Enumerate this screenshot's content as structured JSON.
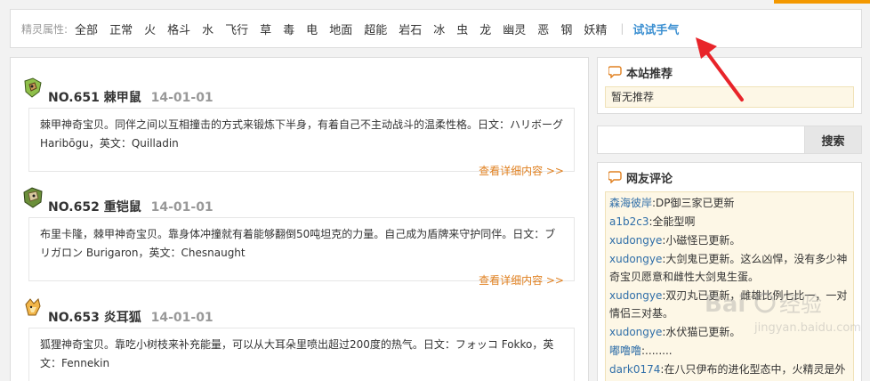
{
  "filter": {
    "label": "精灵属性:",
    "items": [
      "全部",
      "正常",
      "火",
      "格斗",
      "水",
      "飞行",
      "草",
      "毒",
      "电",
      "地面",
      "超能",
      "岩石",
      "冰",
      "虫",
      "龙",
      "幽灵",
      "恶",
      "钢",
      "妖精"
    ],
    "separator": "|",
    "try_luck": "试试手气"
  },
  "entries": [
    {
      "number": "NO.651",
      "name": "棘甲鼠",
      "date": "14-01-01",
      "desc": "棘甲神奇宝贝。同伴之间以互相撞击的方式来锻炼下半身，有着自己不主动战斗的温柔性格。日文：ハリボーグ Haribōgu，英文：Quilladin",
      "more": "查看详细内容 >>"
    },
    {
      "number": "NO.652",
      "name": "重铠鼠",
      "date": "14-01-01",
      "desc": "布里卡隆，棘甲神奇宝贝。靠身体冲撞就有着能够翻倒50吨坦克的力量。自己成为盾牌来守护同伴。日文：ブリガロン Burigaron，英文：Chesnaught",
      "more": "查看详细内容 >>"
    },
    {
      "number": "NO.653",
      "name": "炎耳狐",
      "date": "14-01-01",
      "desc": "狐狸神奇宝贝。靠吃小树枝来补充能量，可以从大耳朵里喷出超过200度的热气。日文：フォッコ Fokko，英文：Fennekin",
      "more": ""
    }
  ],
  "recommend": {
    "title": "本站推荐",
    "body": "暂无推荐"
  },
  "search": {
    "button": "搜索",
    "placeholder": ""
  },
  "comments": {
    "title": "网友评论",
    "items": [
      {
        "user": "森海彼岸",
        "text": ":DP御三家已更新"
      },
      {
        "user": "a1b2c3",
        "text": ":全能型啊"
      },
      {
        "user": "xudongye",
        "text": ":小磁怪已更新。"
      },
      {
        "user": "xudongye",
        "text": ":大剑鬼已更新。这么凶悍，没有多少神奇宝贝愿意和雌性大剑鬼生蛋。"
      },
      {
        "user": "xudongye",
        "text": ":双刃丸已更新，雌雄比例七比一，一对情侣三对基。"
      },
      {
        "user": "xudongye",
        "text": ":水伏猫已更新。"
      },
      {
        "user": "嘟噜噜",
        "text": ":........"
      },
      {
        "user": "dark0174",
        "text": ":在八只伊布的进化型态中，火精灵是外表"
      }
    ]
  },
  "colors": {
    "accent_orange": "#f39800",
    "link_blue": "#3b8fd1",
    "more_orange": "#e08020",
    "arrow_red": "#e8242a"
  },
  "watermark": "Bai经验 jingyan.baidu.com"
}
